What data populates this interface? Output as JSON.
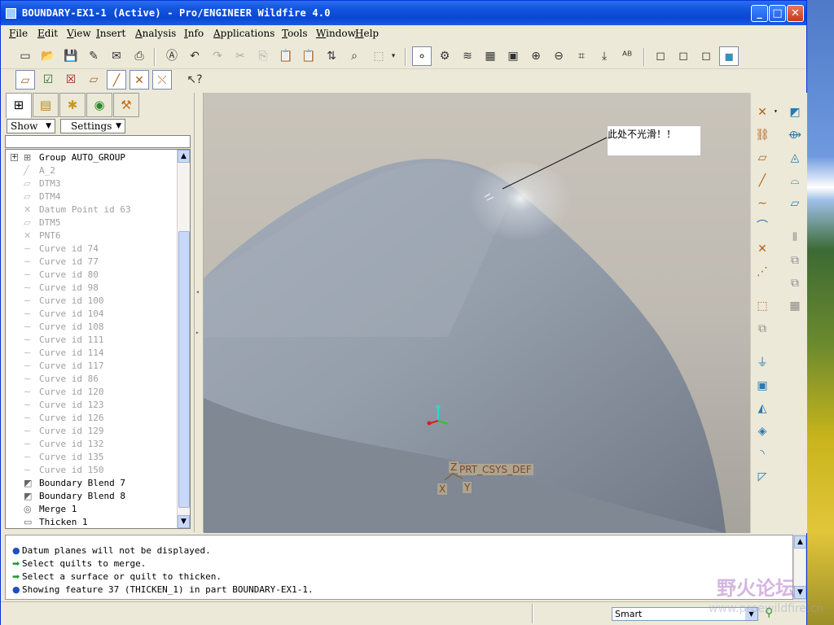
{
  "window": {
    "title": "BOUNDARY-EX1-1 (Active) - Pro/ENGINEER Wildfire 4.0",
    "minimize": "_",
    "maximize": "□",
    "close": "✕"
  },
  "menu": [
    "File",
    "Edit",
    "View",
    "Insert",
    "Analysis",
    "Info",
    "Applications",
    "Tools",
    "Window",
    "Help"
  ],
  "navigator": {
    "show_label": "Show",
    "settings_label": "Settings",
    "tree": [
      {
        "label": "Group AUTO_GROUP",
        "icon": "group-icon",
        "dim": false,
        "expand": "+"
      },
      {
        "label": "A_2",
        "icon": "axis-icon",
        "dim": true
      },
      {
        "label": "DTM3",
        "icon": "datum-plane-icon",
        "dim": true
      },
      {
        "label": "DTM4",
        "icon": "datum-plane-icon",
        "dim": true
      },
      {
        "label": "Datum Point id 63",
        "icon": "datum-point-icon",
        "dim": true
      },
      {
        "label": "DTM5",
        "icon": "datum-plane-icon",
        "dim": true
      },
      {
        "label": "PNT6",
        "icon": "datum-point-icon",
        "dim": true
      },
      {
        "label": "Curve id 74",
        "icon": "curve-icon",
        "dim": true
      },
      {
        "label": "Curve id 77",
        "icon": "curve-icon",
        "dim": true
      },
      {
        "label": "Curve id 80",
        "icon": "curve-icon",
        "dim": true
      },
      {
        "label": "Curve id 98",
        "icon": "curve-icon",
        "dim": true
      },
      {
        "label": "Curve id 100",
        "icon": "curve-icon",
        "dim": true
      },
      {
        "label": "Curve id 104",
        "icon": "curve-icon",
        "dim": true
      },
      {
        "label": "Curve id 108",
        "icon": "curve-icon",
        "dim": true
      },
      {
        "label": "Curve id 111",
        "icon": "curve-icon",
        "dim": true
      },
      {
        "label": "Curve id 114",
        "icon": "curve-icon",
        "dim": true
      },
      {
        "label": "Curve id 117",
        "icon": "curve-icon",
        "dim": true
      },
      {
        "label": "Curve id 86",
        "icon": "curve-icon",
        "dim": true
      },
      {
        "label": "Curve id 120",
        "icon": "curve-icon",
        "dim": true
      },
      {
        "label": "Curve id 123",
        "icon": "curve-icon",
        "dim": true
      },
      {
        "label": "Curve id 126",
        "icon": "curve-icon",
        "dim": true
      },
      {
        "label": "Curve id 129",
        "icon": "curve-icon",
        "dim": true
      },
      {
        "label": "Curve id 132",
        "icon": "curve-icon",
        "dim": true
      },
      {
        "label": "Curve id 135",
        "icon": "curve-icon",
        "dim": true
      },
      {
        "label": "Curve id 150",
        "icon": "curve-icon",
        "dim": true
      },
      {
        "label": "Boundary Blend 7",
        "icon": "boundary-blend-icon",
        "dim": false
      },
      {
        "label": "Boundary Blend 8",
        "icon": "boundary-blend-icon",
        "dim": false
      },
      {
        "label": "Merge 1",
        "icon": "merge-icon",
        "dim": false
      },
      {
        "label": "Thicken 1",
        "icon": "thicken-icon",
        "dim": false
      }
    ]
  },
  "viewport": {
    "note_text": "此处不光滑！！",
    "csys_name": "PRT_CSYS_DEF",
    "csys_z": "Z",
    "csys_x": "X",
    "csys_y": "Y",
    "background_top": "#c9c4ba",
    "surface_color": "#97a0ac"
  },
  "messages": [
    {
      "type": "info",
      "text": "Datum planes will not be displayed."
    },
    {
      "type": "prompt",
      "text": "Select quilts to merge."
    },
    {
      "type": "prompt",
      "text": "Select a surface or quilt to thicken."
    },
    {
      "type": "info",
      "text": "Showing feature 37 (THICKEN_1) in part BOUNDARY-EX1-1."
    }
  ],
  "status": {
    "filter_value": "Smart"
  },
  "watermark": {
    "text": "野火论坛",
    "url": "www.proewildfire.cn"
  }
}
